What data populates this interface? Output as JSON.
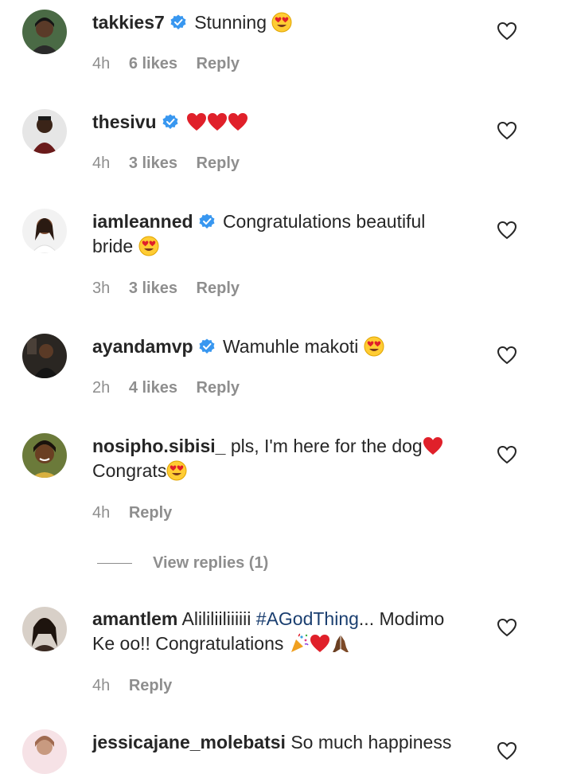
{
  "comments": [
    {
      "username": "takkies7",
      "verified": true,
      "text": "Stunning",
      "emojis_after": [
        "heart-eyes"
      ],
      "text2": "",
      "emojis_after2": [],
      "time": "4h",
      "likes": "6 likes",
      "reply": "Reply",
      "avatar_color": "#3a5a3a"
    },
    {
      "username": "thesivu",
      "verified": true,
      "text": "",
      "emojis_after": [
        "red-heart",
        "red-heart",
        "red-heart"
      ],
      "text2": "",
      "emojis_after2": [],
      "time": "4h",
      "likes": "3 likes",
      "reply": "Reply",
      "avatar_color": "#d9d9d9"
    },
    {
      "username": "iamleanned",
      "verified": true,
      "text": "Congratulations beautiful",
      "emojis_after": [],
      "text2": "bride",
      "emojis_after2": [
        "heart-eyes"
      ],
      "time": "3h",
      "likes": "3 likes",
      "reply": "Reply",
      "avatar_color": "#eeeeee"
    },
    {
      "username": "ayandamvp",
      "verified": true,
      "text": "Wamuhle makoti",
      "emojis_after": [
        "heart-eyes"
      ],
      "text2": "",
      "emojis_after2": [],
      "time": "2h",
      "likes": "4 likes",
      "reply": "Reply",
      "avatar_color": "#2b2a28"
    },
    {
      "username": "nosipho.sibisi_",
      "verified": false,
      "text": "pls, I'm here for the dog",
      "emojis_after": [
        "red-heart"
      ],
      "text2": "Congrats",
      "emojis_after2": [
        "heart-eyes"
      ],
      "time": "4h",
      "likes": "",
      "reply": "Reply",
      "avatar_color": "#5a6b3a"
    },
    {
      "username": "amantlem",
      "verified": false,
      "text": "Alililiiliiiiii",
      "hashtag": "#AGodThing",
      "text_after_hashtag": "... Modimo",
      "text2": "Ke oo!! Congratulations",
      "emojis_after2": [
        "party-popper",
        "red-heart",
        "folded-hands"
      ],
      "time": "4h",
      "likes": "",
      "reply": "Reply",
      "avatar_color": "#3a2a22"
    },
    {
      "username": "jessicajane_molebatsi",
      "verified": false,
      "text": "So much happiness",
      "avatar_color": "#f4d4d8"
    }
  ],
  "view_replies": "View replies (1)",
  "colors": {
    "verified": "#3897f0",
    "muted": "#8e8e8e",
    "text": "#262626",
    "hashtag": "#1b3f70",
    "heart_emoji": "#e0202a"
  }
}
